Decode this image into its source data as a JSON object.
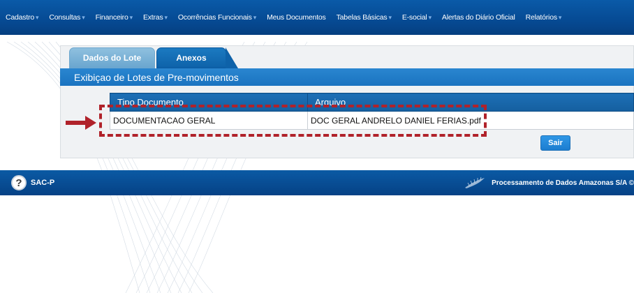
{
  "menu": {
    "items": [
      {
        "label": "Cadastro",
        "caret": true
      },
      {
        "label": "Consultas",
        "caret": true
      },
      {
        "label": "Financeiro",
        "caret": true
      },
      {
        "label": "Extras",
        "caret": true
      },
      {
        "label": "Ocorrências Funcionais",
        "caret": true
      },
      {
        "label": "Meus Documentos",
        "caret": false
      },
      {
        "label": "Tabelas Básicas",
        "caret": true
      },
      {
        "label": "E-social",
        "caret": true
      },
      {
        "label": "Alertas do Diário Oficial",
        "caret": false
      },
      {
        "label": "Relatórios",
        "caret": true
      }
    ]
  },
  "tabs": {
    "lote": "Dados do Lote",
    "anexos": "Anexos"
  },
  "section_title": "Exibiçao de Lotes de Pre-movimentos",
  "table": {
    "headers": [
      "Tipo Documento",
      "Arquivo"
    ],
    "rows": [
      [
        "DOCUMENTACAO GERAL",
        "DOC GERAL ANDRELO DANIEL FERIAS.pdf"
      ]
    ]
  },
  "buttons": {
    "sair": "Sair"
  },
  "footer": {
    "help_label": "SAC-P",
    "company": "Processamento de Dados Amazonas S/A ©"
  },
  "colors": {
    "menubar": "#064a93",
    "accent": "#1a73c0",
    "highlight": "#b0222a"
  }
}
